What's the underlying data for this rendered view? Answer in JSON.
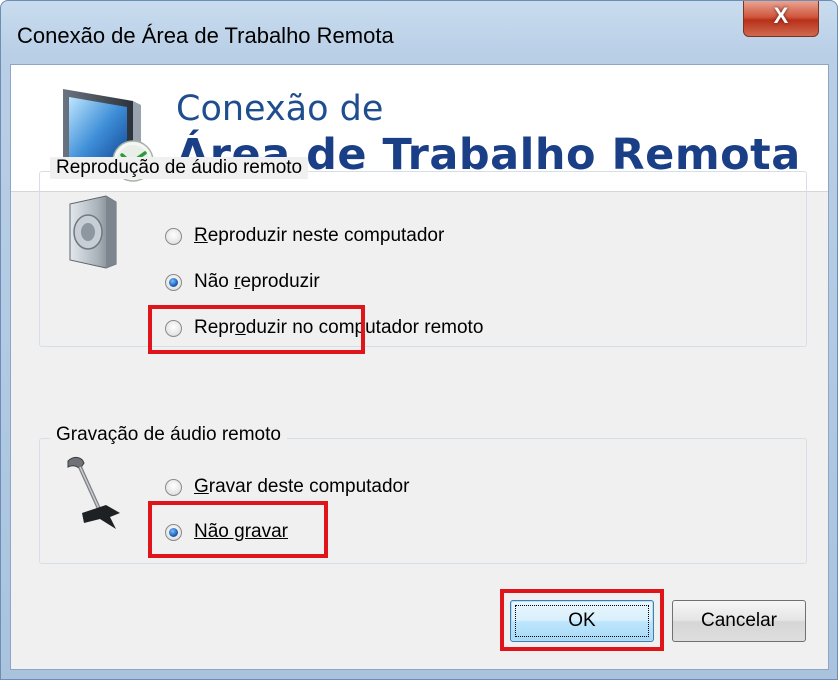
{
  "window": {
    "title": "Conexão de Área de Trabalho Remota",
    "close_glyph": "X"
  },
  "banner": {
    "line1": "Conexão de",
    "line2": "Área de Trabalho Remota",
    "icon": "remote-desktop-monitor-icon"
  },
  "playback": {
    "legend": "Reprodução de áudio remoto",
    "icon": "speaker-icon",
    "options": [
      {
        "pre": "",
        "u": "R",
        "post": "eproduzir neste computador",
        "checked": false
      },
      {
        "pre": "Não ",
        "u": "r",
        "post": "eproduzir",
        "checked": true
      },
      {
        "pre": "Repr",
        "u": "o",
        "post": "duzir no computador remoto",
        "checked": false
      }
    ]
  },
  "recording": {
    "legend": "Gravação de áudio remoto",
    "icon": "microphone-icon",
    "options": [
      {
        "pre": "",
        "u": "G",
        "post": "ravar deste computador",
        "checked": false
      },
      {
        "pre": "",
        "u": "Não gravar",
        "post": "",
        "checked": true
      }
    ]
  },
  "buttons": {
    "ok": "OK",
    "cancel": "Cancelar"
  },
  "colors": {
    "highlight": "#e0151c",
    "banner_text": "#1a3f86"
  }
}
